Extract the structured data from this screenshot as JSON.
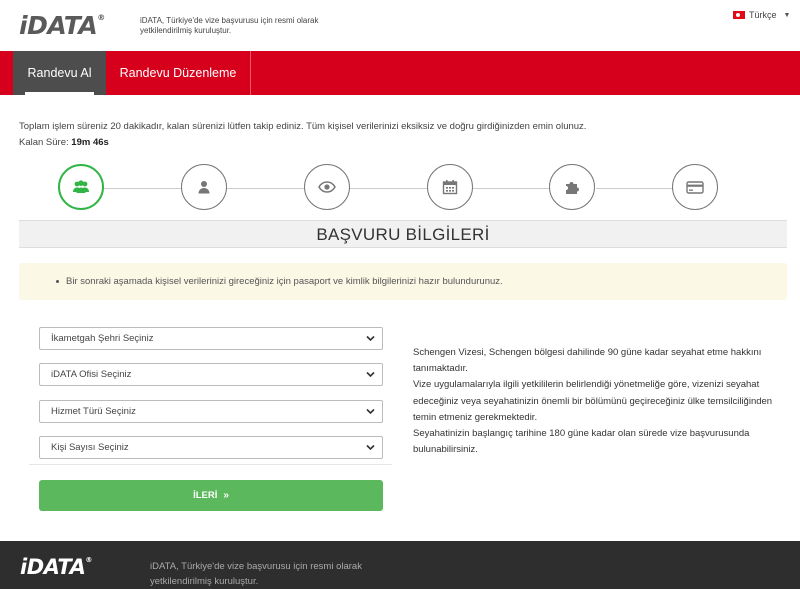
{
  "header": {
    "logo": "iDATA",
    "logo_mark": "®",
    "tagline": "iDATA, Türkiye'de vize başvurusu için resmi olarak yetkilendirilmiş kuruluştur.",
    "language": "Türkçe",
    "flag_icon": "turkey-flag-icon"
  },
  "nav": {
    "tabs": [
      {
        "label": "Randevu Al",
        "active": true
      },
      {
        "label": "Randevu Düzenleme",
        "active": false
      }
    ]
  },
  "main": {
    "notice": "Toplam işlem süreniz 20 dakikadır, kalan sürenizi lütfen takip ediniz. Tüm kişisel verilerinizi eksiksiz ve doğru girdiğinizden emin olunuz.",
    "timer_label": "Kalan Süre:",
    "timer_value": "19m 46s",
    "steps": [
      {
        "icon": "users-icon",
        "active": true
      },
      {
        "icon": "user-icon",
        "active": false
      },
      {
        "icon": "eye-icon",
        "active": false
      },
      {
        "icon": "calendar-icon",
        "active": false
      },
      {
        "icon": "puzzle-icon",
        "active": false
      },
      {
        "icon": "credit-card-icon",
        "active": false
      }
    ],
    "section_title": "BAŞVURU BİLGİLERİ",
    "alert": "Bir sonraki aşamada kişisel verilerinizi gireceğiniz için pasaport ve kimlik bilgilerinizi hazır bulundurunuz.",
    "form": {
      "city_select": "İkametgah Şehri Seçiniz",
      "office_select": "iDATA Ofisi Seçiniz",
      "service_select": "Hizmet Türü Seçiniz",
      "people_select": "Kişi Sayısı Seçiniz",
      "next_button": "İLERİ",
      "next_arrow": "»"
    },
    "info": [
      "Schengen Vizesi, Schengen bölgesi dahilinde 90 güne kadar seyahat etme hakkını tanımaktadır.",
      "Vize uygulamalarıyla ilgili yetkililerin belirlendiği yönetmeliğe göre, vizenizi seyahat edeceğiniz veya seyahatinizin önemli bir bölümünü geçireceğiniz ülke temsilciliğinden temin etmeniz gerekmektedir.",
      "Seyahatinizin başlangıç tarihine 180 güne kadar olan sürede vize başvurusunda bulunabilirsiniz."
    ]
  },
  "footer": {
    "logo": "iDATA",
    "logo_mark": "®",
    "text": "iDATA, Türkiye'de vize başvurusu için resmi olarak yetkilendirilmiş kuruluştur."
  },
  "colors": {
    "brand_red": "#d6001c",
    "active_tab": "#4d4d4d",
    "success_green": "#5cb85c",
    "step_active": "#31b545",
    "alert_bg": "#fcf8e6",
    "footer_bg": "#2e2e2e"
  }
}
